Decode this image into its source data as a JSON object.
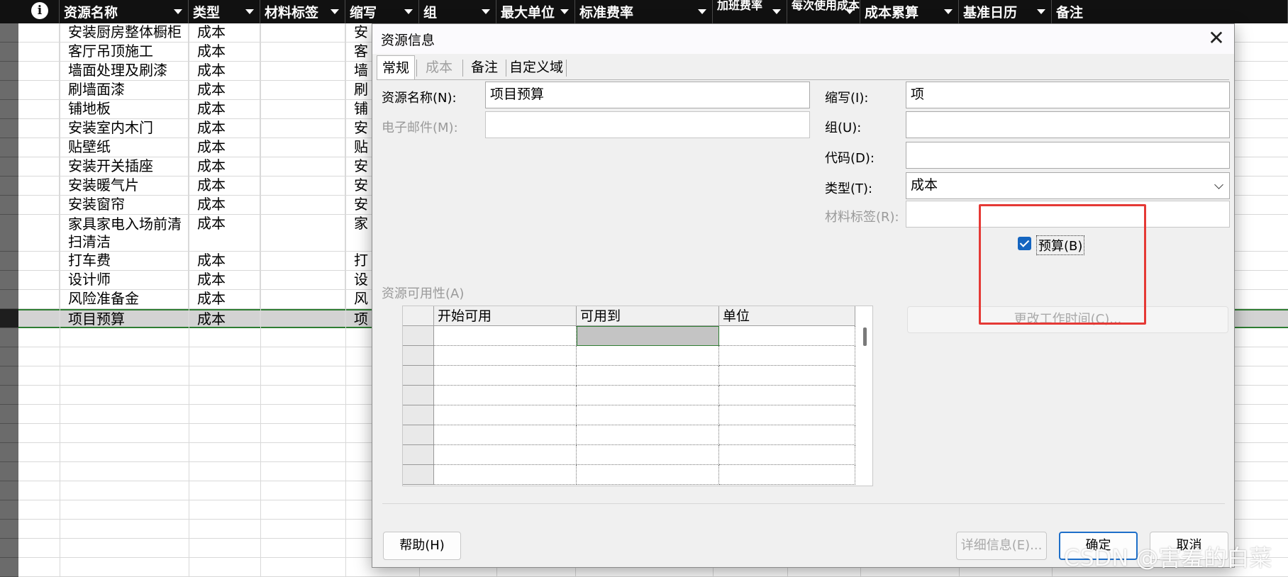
{
  "columns": [
    {
      "label": "",
      "icon": "info-icon"
    },
    {
      "label": "资源名称"
    },
    {
      "label": "类型"
    },
    {
      "label": "材料标签"
    },
    {
      "label": "缩写"
    },
    {
      "label": "组"
    },
    {
      "label": "最大单位"
    },
    {
      "label": "标准费率"
    },
    {
      "label": "加班费率"
    },
    {
      "label": "每次使用成本"
    },
    {
      "label": "成本累算"
    },
    {
      "label": "基准日历"
    },
    {
      "label": "备注"
    }
  ],
  "rows": [
    {
      "name": "安装厨房整体橱柜",
      "type": "成本",
      "abbr": "安"
    },
    {
      "name": "客厅吊顶施工",
      "type": "成本",
      "abbr": "客"
    },
    {
      "name": "墙面处理及刷漆",
      "type": "成本",
      "abbr": "墙"
    },
    {
      "name": "刷墙面漆",
      "type": "成本",
      "abbr": "刷"
    },
    {
      "name": "铺地板",
      "type": "成本",
      "abbr": "铺"
    },
    {
      "name": "安装室内木门",
      "type": "成本",
      "abbr": "安"
    },
    {
      "name": "贴壁纸",
      "type": "成本",
      "abbr": "贴"
    },
    {
      "name": "安装开关插座",
      "type": "成本",
      "abbr": "安"
    },
    {
      "name": "安装暖气片",
      "type": "成本",
      "abbr": "安"
    },
    {
      "name": "安装窗帘",
      "type": "成本",
      "abbr": "安"
    },
    {
      "name": "家具家电入场前清扫清洁",
      "type": "成本",
      "abbr": "家"
    },
    {
      "name": "打车费",
      "type": "成本",
      "abbr": "打"
    },
    {
      "name": "设计师",
      "type": "成本",
      "abbr": "设"
    },
    {
      "name": "风险准备金",
      "type": "成本",
      "abbr": "风"
    },
    {
      "name": "项目预算",
      "type": "成本",
      "abbr": "项"
    }
  ],
  "dialog": {
    "title": "资源信息",
    "close_glyph": "✕",
    "tabs": [
      "常规",
      "成本",
      "备注",
      "自定义域"
    ],
    "labels": {
      "name": "资源名称(N):",
      "email": "电子邮件(M):",
      "abbr": "缩写(I):",
      "group": "组(U):",
      "code": "代码(D):",
      "type": "类型(T):",
      "material": "材料标签(R):",
      "availability": "资源可用性(A)"
    },
    "values": {
      "name": "项目预算",
      "email": "",
      "abbr": "项",
      "group": "",
      "code": "",
      "type": "成本",
      "material": ""
    },
    "budget_checkbox": {
      "label": "预算(B)",
      "checked": true
    },
    "availability_columns": [
      "开始可用",
      "可用到",
      "单位"
    ],
    "change_worktime": "更改工作时间(C)...",
    "buttons": {
      "help": "帮助(H)",
      "details": "详细信息(E)...",
      "ok": "确定",
      "cancel": "取消"
    }
  },
  "watermark": "CSDN @害羞的白菜",
  "colors": {
    "highlight": "#e53935",
    "checkbox": "#1565c0",
    "selection_border": "#2e7d32"
  }
}
